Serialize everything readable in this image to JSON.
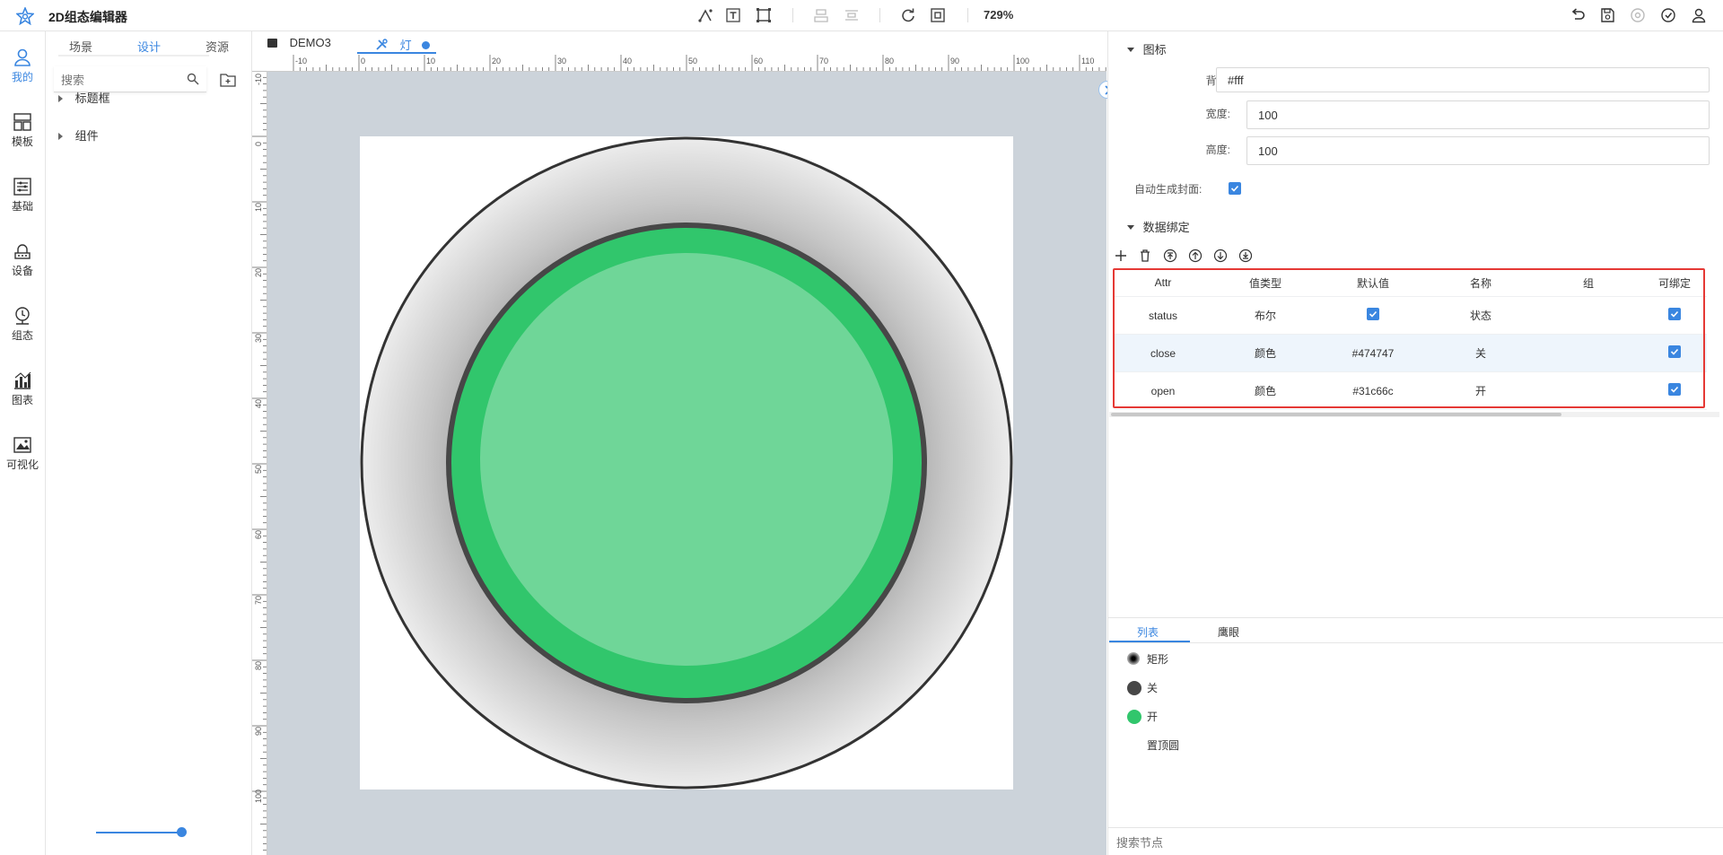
{
  "app": {
    "title": "2D组态编辑器",
    "zoom": "729%"
  },
  "rail": {
    "items": [
      {
        "label": "我的",
        "icon": "user-icon"
      },
      {
        "label": "模板",
        "icon": "template-icon"
      },
      {
        "label": "基础",
        "icon": "basic-shapes-icon"
      },
      {
        "label": "设备",
        "icon": "device-icon"
      },
      {
        "label": "组态",
        "icon": "scada-icon"
      },
      {
        "label": "图表",
        "icon": "chart-icon"
      },
      {
        "label": "可视化",
        "icon": "visualization-icon"
      }
    ]
  },
  "left_panel": {
    "tabs": [
      "场景",
      "设计",
      "资源"
    ],
    "active_tab": "设计",
    "search_placeholder": "搜索",
    "tree": [
      "标题框",
      "组件"
    ]
  },
  "doc_tabs": [
    {
      "label": "DEMO3",
      "icon": "image-icon"
    },
    {
      "label": "灯",
      "icon": "tools-icon",
      "modified": true
    }
  ],
  "ruler": {
    "top": [
      "-10",
      "0",
      "10",
      "20",
      "30",
      "40",
      "50",
      "60",
      "70",
      "80",
      "90",
      "100",
      "110"
    ],
    "left": [
      "-10",
      "0",
      "10",
      "20",
      "30",
      "40",
      "50",
      "60",
      "70",
      "80",
      "90",
      "100"
    ]
  },
  "props": {
    "section_icon": "图标",
    "background_label": "背景:",
    "background_value": "#fff",
    "width_label": "宽度:",
    "width_value": "100",
    "height_label": "高度:",
    "height_value": "100",
    "auto_cover_label": "自动生成封面:",
    "auto_cover_checked": true,
    "section_binding": "数据绑定"
  },
  "bind_table": {
    "headers": [
      "Attr",
      "值类型",
      "默认值",
      "名称",
      "组",
      "可绑定"
    ],
    "rows": [
      {
        "attr": "status",
        "type": "布尔",
        "default": "",
        "default_checked": true,
        "name": "状态",
        "group": "",
        "bindable": true
      },
      {
        "attr": "close",
        "type": "颜色",
        "default": "#474747",
        "name": "关",
        "group": "",
        "bindable": true
      },
      {
        "attr": "open",
        "type": "颜色",
        "default": "#31c66c",
        "name": "开",
        "group": "",
        "bindable": true
      }
    ]
  },
  "layers": {
    "tabs": [
      "列表",
      "鹰眼"
    ],
    "active_tab": "列表",
    "items": [
      {
        "label": "矩形",
        "color": "#000000"
      },
      {
        "label": "关",
        "color": "#474747"
      },
      {
        "label": "开",
        "color": "#31c66c"
      },
      {
        "label": "置顶圆",
        "color": ""
      }
    ],
    "search_placeholder": "搜索节点"
  },
  "colors": {
    "accent": "#3a86e0",
    "lamp_on": "#31c66c",
    "lamp_off": "#474747",
    "highlight": "#e53935"
  }
}
